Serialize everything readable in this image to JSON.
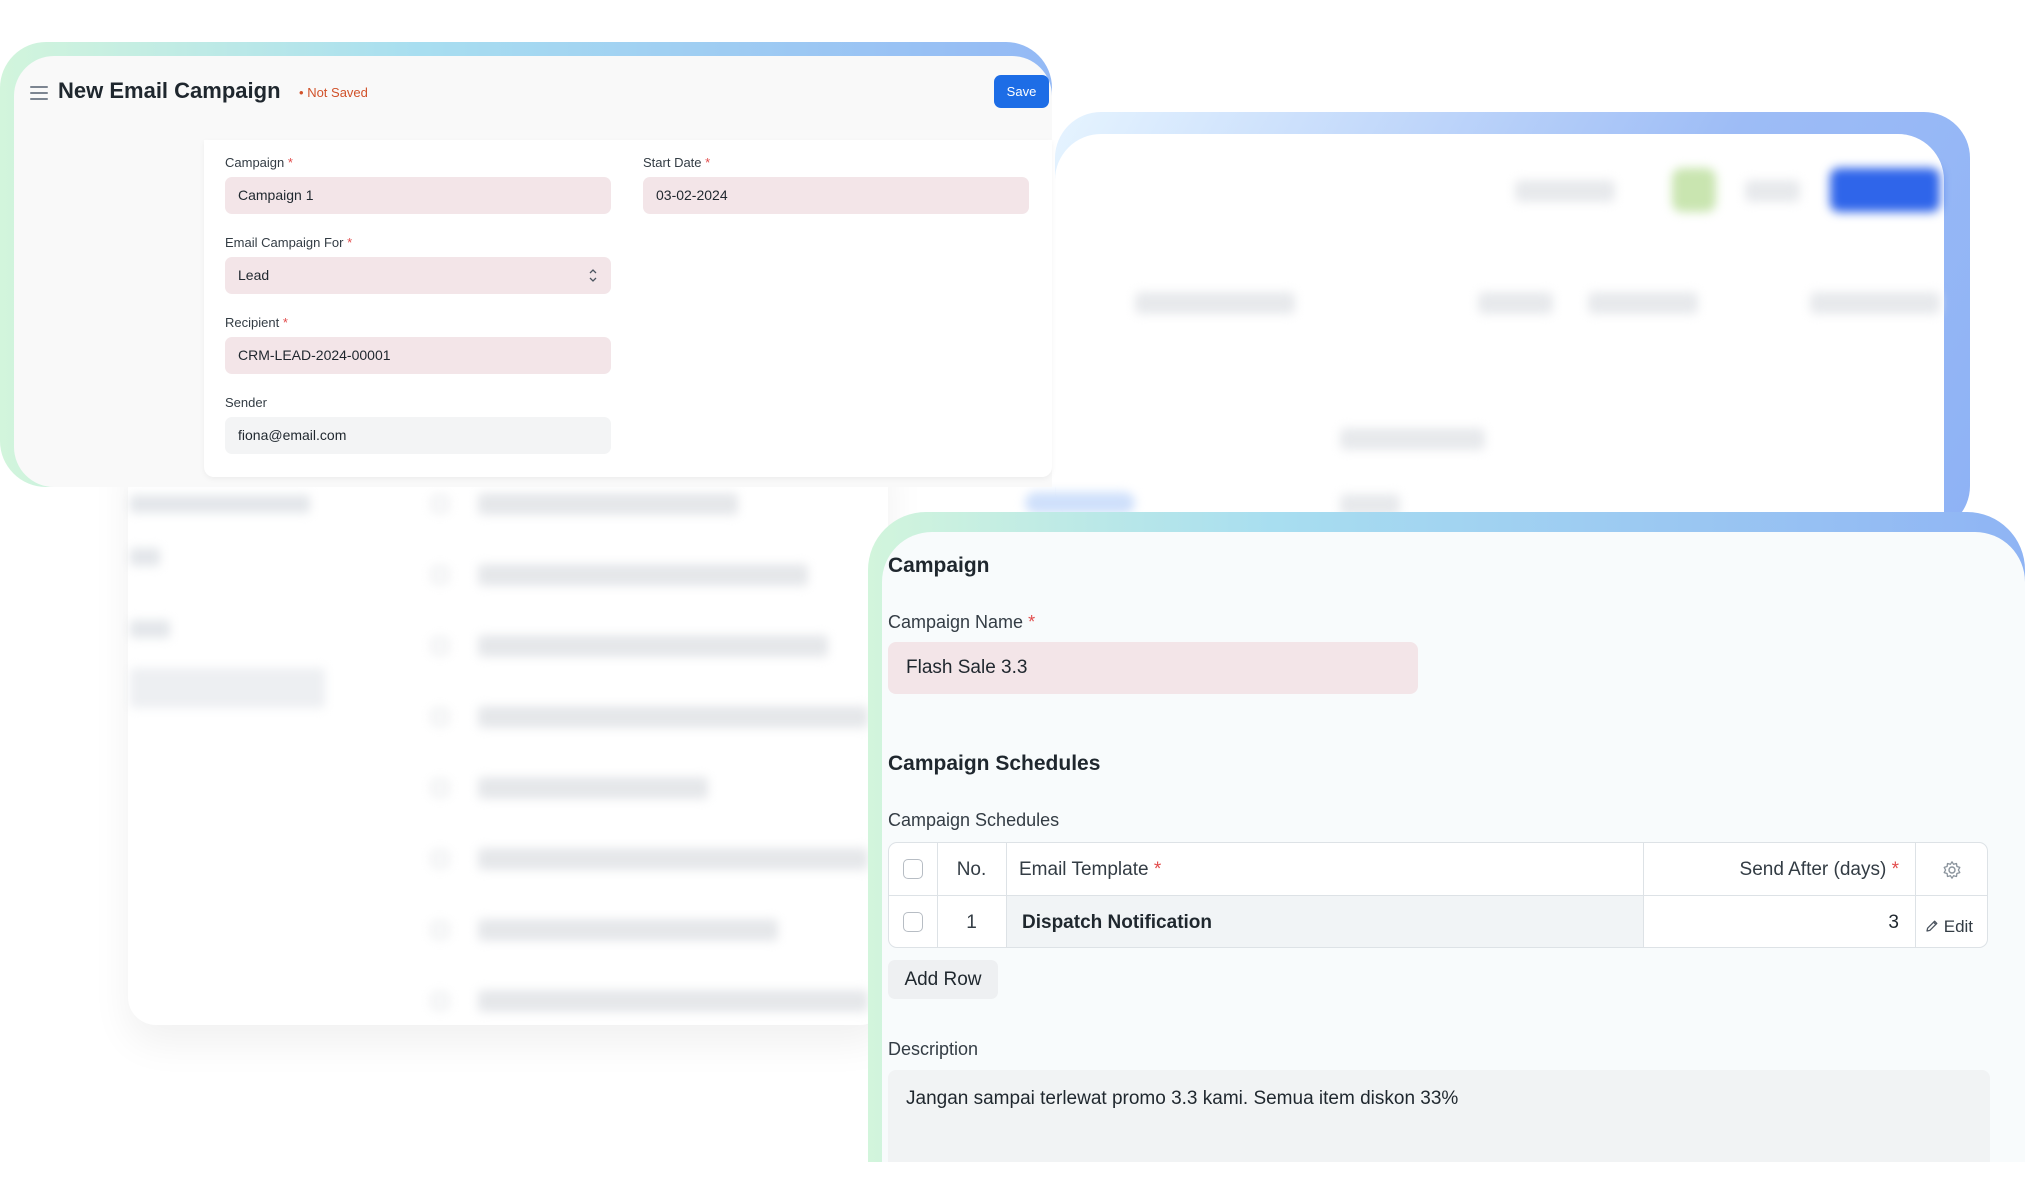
{
  "form": {
    "title": "New Email Campaign",
    "status": "Not Saved",
    "save_label": "Save",
    "campaign": {
      "label": "Campaign",
      "value": "Campaign 1"
    },
    "start_date": {
      "label": "Start Date",
      "value": "03-02-2024"
    },
    "campaign_for": {
      "label": "Email Campaign For",
      "value": "Lead"
    },
    "recipient": {
      "label": "Recipient",
      "value": "CRM-LEAD-2024-00001"
    },
    "sender": {
      "label": "Sender",
      "value": "fiona@email.com"
    },
    "required_mark": "*"
  },
  "campaign": {
    "section_title": "Campaign",
    "name_label": "Campaign Name",
    "name_value": "Flash Sale 3.3",
    "schedules_title": "Campaign Schedules",
    "schedules_label": "Campaign Schedules",
    "table": {
      "columns": {
        "no": "No.",
        "template": "Email Template",
        "send_after": "Send After (days)"
      },
      "rows": [
        {
          "no": "1",
          "template": "Dispatch Notification",
          "send_after": "3",
          "edit": "Edit"
        }
      ]
    },
    "add_row_label": "Add Row",
    "description_label": "Description",
    "description_value": "Jangan sampai terlewat promo 3.3 kami. Semua item diskon 33%"
  },
  "colors": {
    "primary": "#1d6de6",
    "status": "#d1522a",
    "required": "#e24c4c",
    "field_bg": "#f3e5e8"
  }
}
